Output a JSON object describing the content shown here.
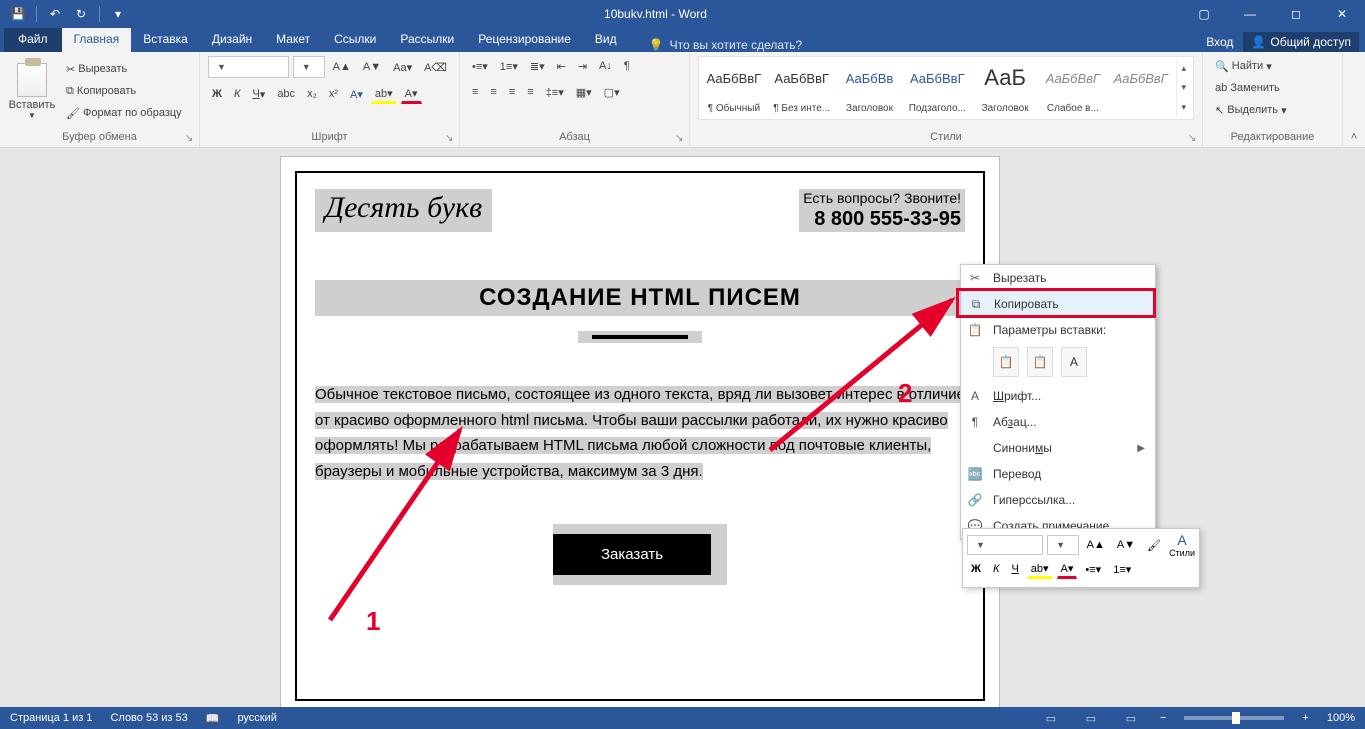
{
  "titlebar": {
    "title": "10bukv.html - Word"
  },
  "tabs": {
    "file": "Файл",
    "items": [
      "Главная",
      "Вставка",
      "Дизайн",
      "Макет",
      "Ссылки",
      "Рассылки",
      "Рецензирование",
      "Вид"
    ],
    "active": 0,
    "tellme": "Что вы хотите сделать?",
    "signin": "Вход",
    "share": "Общий доступ"
  },
  "ribbon": {
    "clipboard": {
      "paste": "Вставить",
      "cut": "Вырезать",
      "copy": "Копировать",
      "format_painter": "Формат по образцу",
      "group": "Буфер обмена"
    },
    "font": {
      "group": "Шрифт",
      "family": "",
      "size": ""
    },
    "paragraph": {
      "group": "Абзац"
    },
    "styles": {
      "group": "Стили",
      "items": [
        {
          "preview": "АаБбВвГ",
          "label": "¶ Обычный",
          "cls": ""
        },
        {
          "preview": "АаБбВвГ",
          "label": "¶ Без инте...",
          "cls": ""
        },
        {
          "preview": "АаБбВв",
          "label": "Заголовок",
          "cls": "blue"
        },
        {
          "preview": "АаБбВвГ",
          "label": "Подзаголо...",
          "cls": "blue"
        },
        {
          "preview": "АаБ",
          "label": "Заголовок",
          "cls": "big"
        },
        {
          "preview": "АаБбВвГ",
          "label": "Слабое в...",
          "cls": "gray"
        },
        {
          "preview": "АаБбВвГ",
          "label": "",
          "cls": "gray"
        }
      ]
    },
    "editing": {
      "find": "Найти",
      "replace": "Заменить",
      "select": "Выделить",
      "group": "Редактирование"
    }
  },
  "document": {
    "logo": "Десять букв",
    "question": "Есть вопросы? Звоните!",
    "phone": "8 800 555-33-95",
    "heading": "СОЗДАНИЕ HTML ПИСЕМ",
    "body": "Обычное текстовое письмо, состоящее из одного текста, вряд ли вызовет интерес в отличие от красиво оформленного html письма. Чтобы ваши рассылки работали, их нужно красиво оформлять! Мы разрабатываем HTML письма любой сложности под почтовые клиенты, браузеры и мобильные устройства, максимум за 3 дня.",
    "cta": "Заказать"
  },
  "context_menu": {
    "cut": "Вырезать",
    "copy": "Копировать",
    "paste_options": "Параметры вставки:",
    "font": "Шрифт...",
    "paragraph": "Абзац...",
    "synonyms": "Синонимы",
    "translate": "Перевод",
    "hyperlink": "Гиперссылка...",
    "comment": "Создать примечание"
  },
  "mini_toolbar": {
    "styles": "Стили"
  },
  "status": {
    "page": "Страница 1 из 1",
    "words": "Слово 53 из 53",
    "lang": "русский",
    "zoom": "100%"
  },
  "annotations": {
    "one": "1",
    "two": "2"
  }
}
